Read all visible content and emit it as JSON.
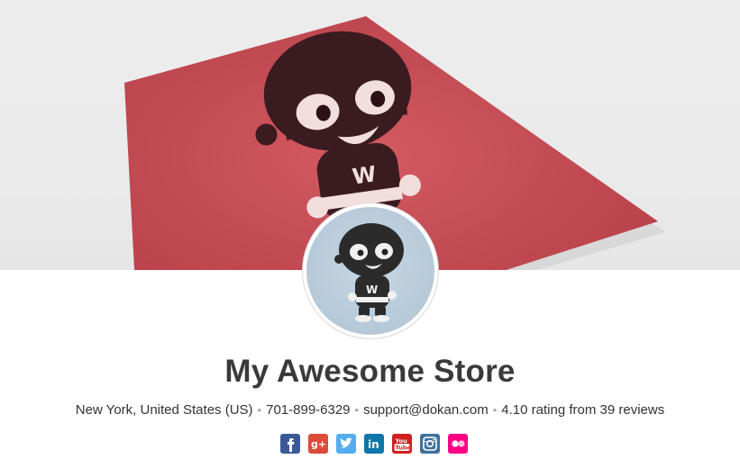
{
  "store": {
    "name": "My Awesome Store",
    "location": "New York, United States (US)",
    "phone": "701-899-6329",
    "email": "support@dokan.com",
    "rating": "4.10 rating from 39 reviews"
  },
  "social": [
    {
      "name": "facebook-icon",
      "glyph": "f"
    },
    {
      "name": "google-plus-icon",
      "glyph": "g+"
    },
    {
      "name": "twitter-icon",
      "glyph": ""
    },
    {
      "name": "linkedin-icon",
      "glyph": "in"
    },
    {
      "name": "youtube-icon",
      "glyph": "You Tube"
    },
    {
      "name": "instagram-icon",
      "glyph": ""
    },
    {
      "name": "flickr-icon",
      "glyph": ""
    }
  ],
  "colors": {
    "facebook": "#3b5998",
    "google_plus": "#dd4b39",
    "twitter": "#55acee",
    "linkedin": "#0e76a8",
    "youtube": "#cd201f",
    "instagram": "#3f729b",
    "flickr": "#ff0084",
    "banner_poster": "#c94f57"
  }
}
